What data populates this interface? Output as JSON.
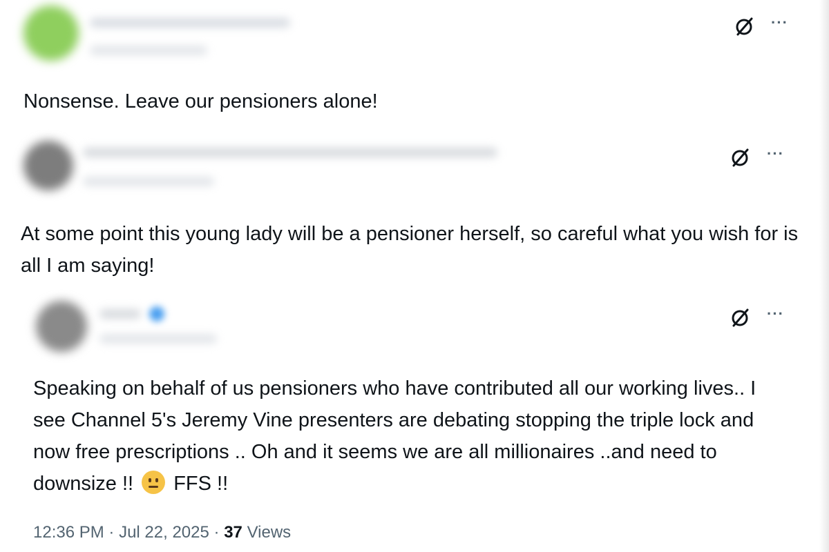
{
  "posts": [
    {
      "text": "Nonsense. Leave our pensioners alone!",
      "more_label": "···"
    },
    {
      "text": "At some point this young lady will be a pensioner herself, so careful what you wish for is all I am saying!",
      "more_label": "···"
    },
    {
      "text_before_emoji": "Speaking on behalf of us pensioners who have contributed all our working lives.. I see Channel 5's Jeremy Vine presenters are debating stopping the triple lock and now free prescriptions .. Oh and it seems we are all millionaires ..and need to downsize !!",
      "text_after_emoji": "FFS !!",
      "emoji": "neutral-face-emoji",
      "more_label": "···"
    }
  ],
  "footer": {
    "time": "12:36 PM",
    "separator": "·",
    "date": "Jul 22, 2025",
    "views_count": "37",
    "views_label": "Views"
  },
  "colors": {
    "text": "#0f1419",
    "secondary": "#536471",
    "verified": "#1d9bf0",
    "emoji": "#f6c347"
  },
  "icons": {
    "grok": "grok-icon",
    "more": "more-icon"
  }
}
